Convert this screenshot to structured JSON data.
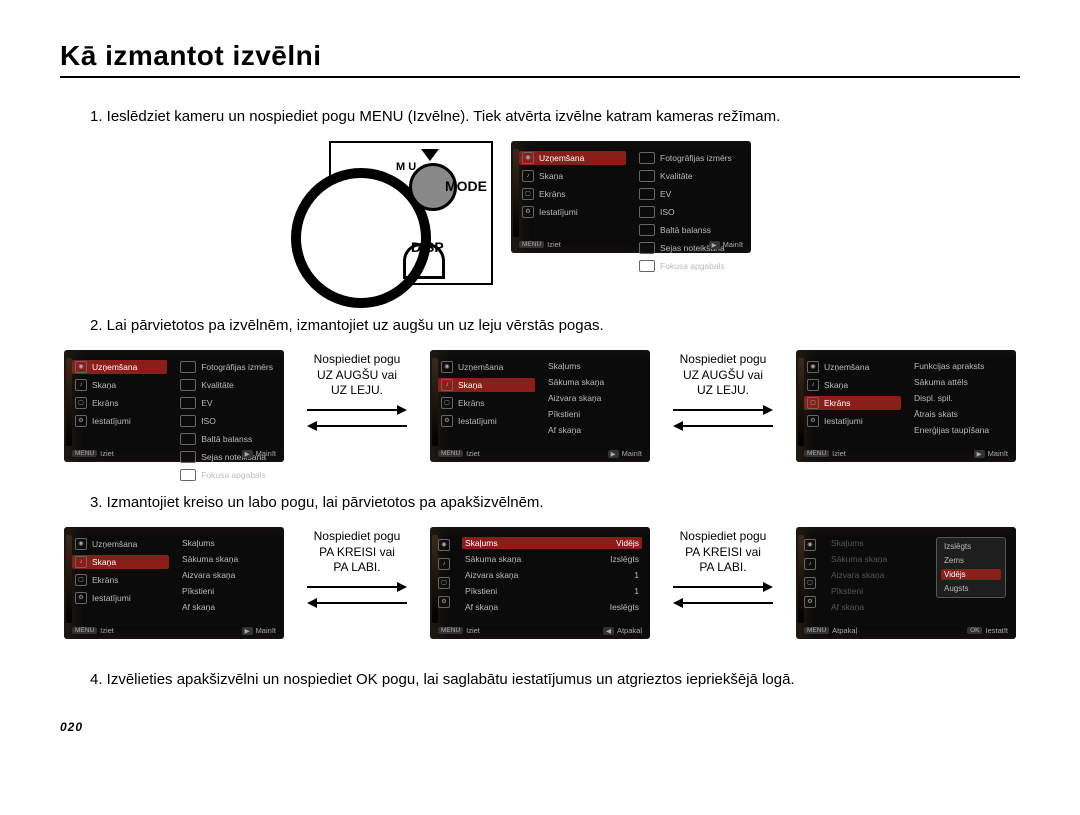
{
  "title": "Kā izmantot izvēlni",
  "steps": {
    "s1": "1. Ieslēdziet kameru un nospiediet pogu MENU (Izvēlne). Tiek atvērta izvēlne katram kameras režīmam.",
    "s2": "2. Lai pārvietotos pa izvēlnēm, izmantojiet uz augšu un uz leju vērstās pogas.",
    "s3": "3. Izmantojiet kreiso un labo pogu, lai pārvietotos pa apakšizvēlnēm.",
    "s4": "4. Izvēlieties apakšizvēlni un nospiediet OK pogu, lai saglabātu iestatījumus un atgrieztos iepriekšējā logā."
  },
  "camera_labels": {
    "mu": "M U",
    "mode": "MODE",
    "disp": "DISP"
  },
  "instr_updown": {
    "l1": "Nospiediet pogu",
    "l2": "UZ AUGŠU vai",
    "l3": "UZ LEJU."
  },
  "instr_lr": {
    "l1": "Nospiediet pogu",
    "l2": "PA KREISI vai",
    "l3": "PA LABI."
  },
  "footer_labels": {
    "menu": "MENU",
    "exit": "Iziet",
    "change": "Mainīt",
    "back": "Atpakaļ",
    "set": "Iestatīt"
  },
  "main_menu": {
    "left": [
      "Uzņemšana",
      "Skaņa",
      "Ekrāns",
      "Iestatījumi"
    ],
    "right_shoot": [
      "Fotogrāfijas izmērs",
      "Kvalitāte",
      "EV",
      "ISO",
      "Baltā balanss",
      "Sejas noteikšana",
      "Fokusa apgabals"
    ],
    "right_sound": [
      "Skaļums",
      "Sākuma skaņa",
      "Aizvara skaņa",
      "Pīkstieni",
      "Af skaņa"
    ],
    "right_screen": [
      "Funkcijas apraksts",
      "Sākuma attēls",
      "Displ. spil.",
      "Ātrais skats",
      "Enerģijas taupīšana"
    ]
  },
  "sound_menu": {
    "skaļums": "Skaļums",
    "vidējs": "Vidējs",
    "rows": [
      {
        "l": "Sākuma skaņa",
        "v": "Izslēgts"
      },
      {
        "l": "Aizvara skaņa",
        "v": "1"
      },
      {
        "l": "Pīkstieni",
        "v": "1"
      },
      {
        "l": "Af skaņa",
        "v": "Ieslēgts"
      }
    ],
    "popup": [
      "Izslēgts",
      "Zems",
      "Vidējs",
      "Augsts"
    ]
  },
  "page_number": "020"
}
